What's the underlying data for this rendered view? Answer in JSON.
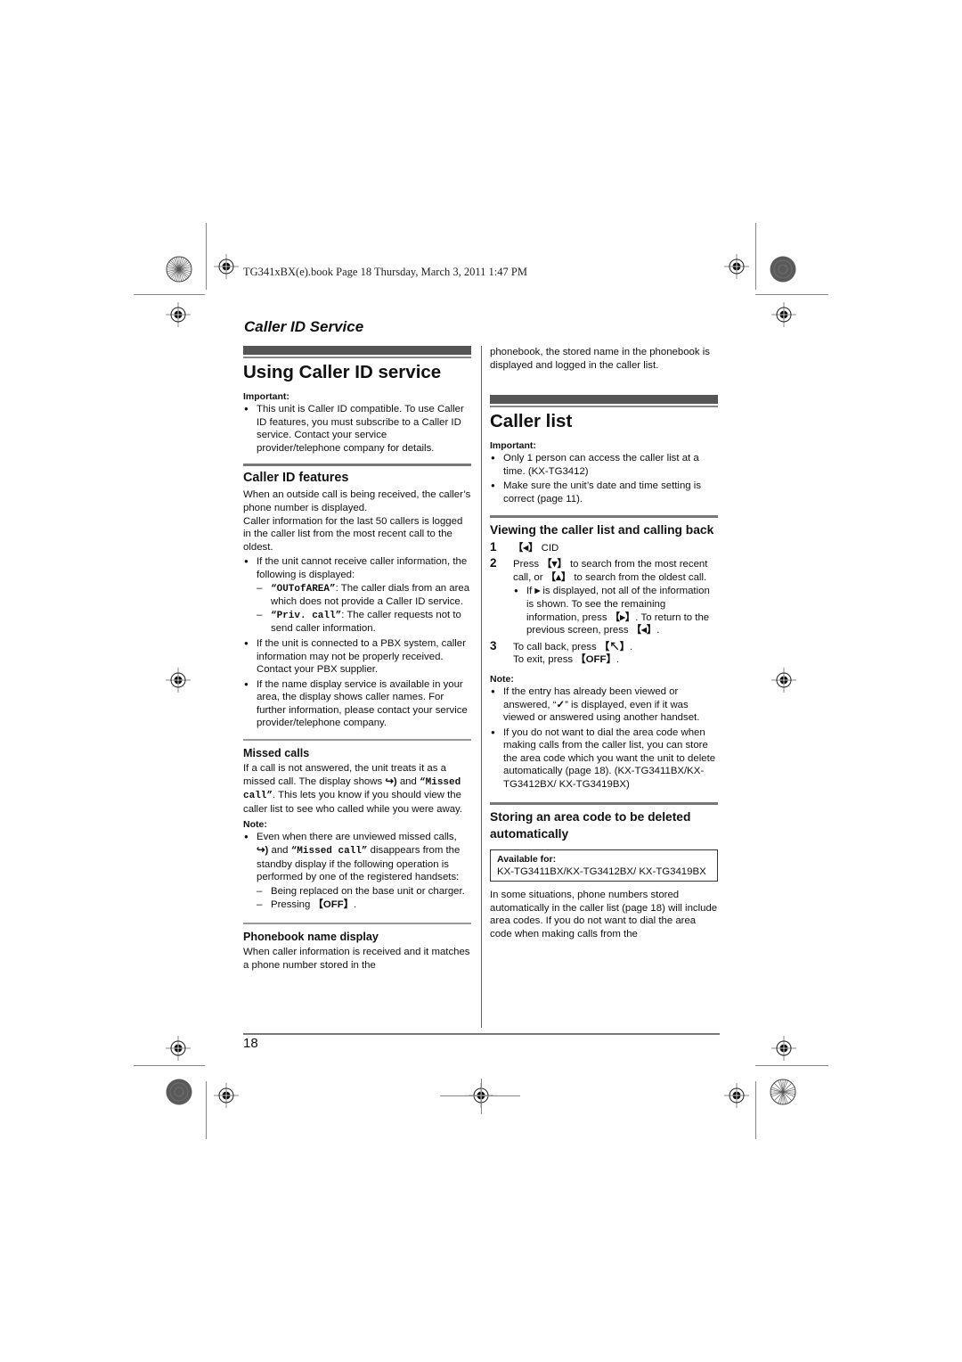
{
  "header_info": "TG341xBX(e).book  Page 18  Thursday, March 3, 2011  1:47 PM",
  "running_head": "Caller ID Service",
  "left_column": {
    "section_title": "Using Caller ID service",
    "important_label": "Important:",
    "important_bullets": [
      "This unit is Caller ID compatible. To use Caller ID features, you must subscribe to a Caller ID service. Contact your service provider/telephone company for details."
    ],
    "features": {
      "title": "Caller ID features",
      "para1": "When an outside call is being received, the caller’s phone number is displayed.",
      "para2": "Caller information for the last 50 callers is logged in the caller list from the most recent call to the oldest.",
      "bullet1": "If the unit cannot receive caller information, the following is displayed:",
      "dash1_code": "“OUTofAREA”",
      "dash1_text": ": The caller dials from an area which does not provide a Caller ID service.",
      "dash2_code": "“Priv. call”",
      "dash2_text": ": The caller requests not to send caller information.",
      "bullet2": "If the unit is connected to a PBX system, caller information may not be properly received. Contact your PBX supplier.",
      "bullet3": "If the name display service is available in your area, the display shows caller names. For further information, please contact your service provider/telephone company."
    },
    "missed": {
      "title": "Missed calls",
      "para_a": "If a call is not answered, the unit treats it as a missed call. The display shows ",
      "icon_glyph": "↪)",
      "para_b": " and ",
      "code": "“Missed call”",
      "para_c": ". This lets you know if you should view the caller list to see who called while you were away.",
      "note_label": "Note:",
      "note_a": "Even when there are unviewed missed calls, ",
      "note_b": " and ",
      "note_c": " disappears from the standby display if the following operation is performed by one of the registered handsets:",
      "dash1": "Being replaced on the base unit or charger.",
      "dash2_a": "Pressing ",
      "dash2_key": "【OFF】",
      "dash2_b": "."
    },
    "phonebook": {
      "title": "Phonebook name display",
      "para": "When caller information is received and it matches a phone number stored in the"
    }
  },
  "right_column": {
    "continued": "phonebook, the stored name in the phonebook is displayed and logged in the caller list.",
    "section_title": "Caller list",
    "important_label": "Important:",
    "important_bullets": [
      "Only 1 person can access the caller list at a time. (KX-TG3412)",
      "Make sure the unit’s date and time setting is correct (page 11)."
    ],
    "viewing": {
      "title": "Viewing the caller list and calling back",
      "steps": [
        {
          "num": "1",
          "key": "【◂】",
          "text": " CID"
        },
        {
          "num": "2",
          "text_a": "Press ",
          "key_down": "【▾】",
          "text_b": " to search from the most recent call, or ",
          "key_up": "【▴】",
          "text_c": " to search from the oldest call.",
          "sub_a": "If ",
          "sub_glyph": "▸",
          "sub_b": " is displayed, not all of the information is shown. To see the remaining information, press ",
          "sub_key_right": "【▸】",
          "sub_c": ". To return to the previous screen, press ",
          "sub_key_left": "【◂】",
          "sub_d": "."
        },
        {
          "num": "3",
          "text_a": "To call back, press ",
          "key_talk": "【↖】",
          "text_b": ".",
          "line2_a": "To exit, press ",
          "key_off": "【OFF】",
          "line2_b": "."
        }
      ],
      "note_label": "Note:",
      "note1_a": "If the entry has already been viewed or answered, “",
      "note1_glyph": "✓",
      "note1_b": "” is displayed, even if it was viewed or answered using another handset.",
      "note2": "If you do not want to dial the area code when making calls from the caller list, you can store the area code which you want the unit to delete automatically (page 18). (KX-TG3411BX/KX-TG3412BX/ KX-TG3419BX)"
    },
    "storing": {
      "title": "Storing an area code to be deleted automatically",
      "available_label": "Available for:",
      "available_models": "KX-TG3411BX/KX-TG3412BX/ KX-TG3419BX",
      "para": "In some situations, phone numbers stored automatically in the caller list (page 18) will include area codes. If you do not want to dial the area code when making calls from the"
    }
  },
  "page_number": "18"
}
